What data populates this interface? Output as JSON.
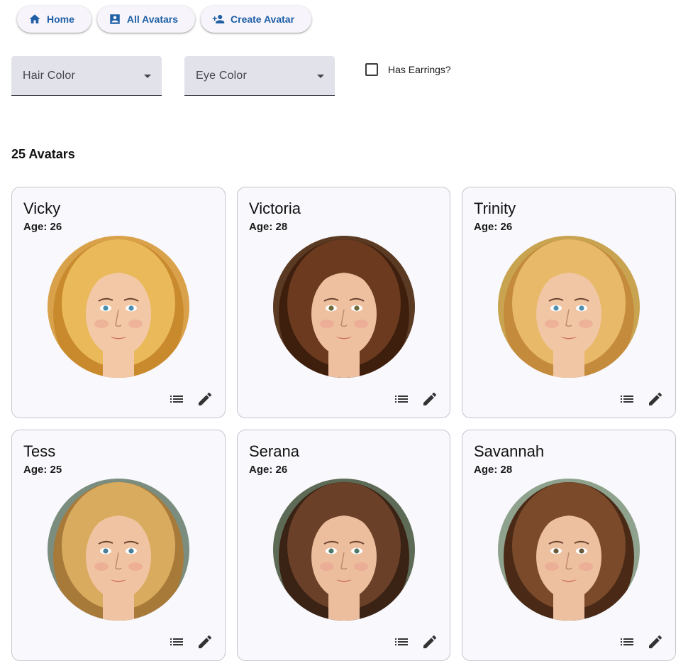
{
  "nav": {
    "home_label": "Home",
    "all_label": "All Avatars",
    "create_label": "Create Avatar"
  },
  "filters": {
    "hair_label": "Hair Color",
    "eye_label": "Eye Color",
    "earrings_label": "Has Earrings?",
    "earrings_checked": false
  },
  "count_label": "25 Avatars",
  "colors": {
    "accent": "#1f5fa6",
    "card_bg": "#f9f8fd",
    "field_bg": "#e1e2ea"
  },
  "avatars": [
    {
      "name": "Vicky",
      "age": "Age: 26",
      "hair": "#e9b95a",
      "hair_dark": "#c98a2e",
      "eyes": "#4a8fb0",
      "bg": "#d9a24a",
      "skin": "#f3c8a6"
    },
    {
      "name": "Victoria",
      "age": "Age: 28",
      "hair": "#6b3a1f",
      "hair_dark": "#3e1e0d",
      "eyes": "#6a6a3a",
      "bg": "#5a3a22",
      "skin": "#eec0a0"
    },
    {
      "name": "Trinity",
      "age": "Age: 26",
      "hair": "#e8b968",
      "hair_dark": "#c48b3d",
      "eyes": "#4f8fae",
      "bg": "#c9a450",
      "skin": "#f1c6a5"
    },
    {
      "name": "Tess",
      "age": "Age: 25",
      "hair": "#d9ab5e",
      "hair_dark": "#a87a3a",
      "eyes": "#4a7f9a",
      "bg": "#7a8d7e",
      "skin": "#f0c4a2"
    },
    {
      "name": "Serana",
      "age": "Age: 26",
      "hair": "#6a4028",
      "hair_dark": "#3a2214",
      "eyes": "#4f7a6a",
      "bg": "#5d6a55",
      "skin": "#ecbe9e"
    },
    {
      "name": "Savannah",
      "age": "Age: 28",
      "hair": "#7a4a2a",
      "hair_dark": "#4a2a16",
      "eyes": "#6a5a3a",
      "bg": "#8fa28d",
      "skin": "#edc0a0"
    }
  ]
}
